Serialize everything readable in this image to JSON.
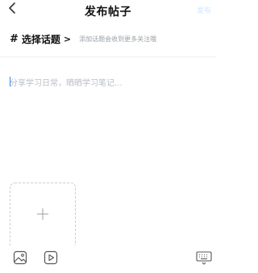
{
  "header": {
    "title": "发布帖子",
    "publish_label": "发布"
  },
  "topic": {
    "label": "选择话题",
    "hint": "添加话题会收到更多关注哦"
  },
  "editor": {
    "placeholder": "分享学习日常，晒晒学习笔记..."
  },
  "icons": {
    "back": "back-arrow-icon",
    "hash": "hash-icon",
    "chevron": "chevron-right-icon",
    "plus": "plus-icon",
    "image": "image-icon",
    "video": "video-icon",
    "keyboard": "keyboard-icon"
  },
  "colors": {
    "publish_disabled": "#cfe6ff",
    "hint_text": "#9aa0a6",
    "caret": "#3b82f6"
  }
}
